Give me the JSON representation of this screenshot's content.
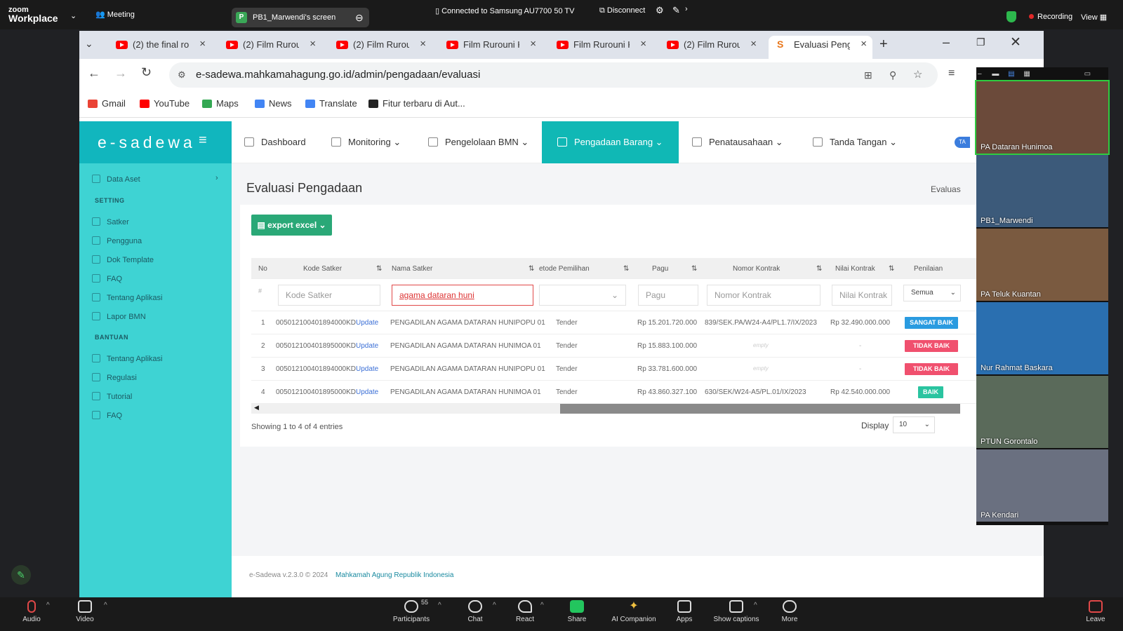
{
  "zoom": {
    "logo_top": "zoom",
    "logo_bottom": "Workplace",
    "meeting_label": "Meeting",
    "share_chip": "P",
    "screen_label": "PB1_Marwendi's screen",
    "connection": "Connected to Samsung AU7700 50 TV",
    "disconnect": "Disconnect",
    "recording": "Recording",
    "view": "View",
    "toolbar": {
      "audio": "Audio",
      "video": "Video",
      "participants": "Participants",
      "participant_count": "55",
      "chat": "Chat",
      "react": "React",
      "share": "Share",
      "ai_companion": "AI Companion",
      "apps": "Apps",
      "captions": "Show captions",
      "more": "More",
      "leave": "Leave"
    }
  },
  "browser": {
    "tabs": [
      {
        "label": "(2) the final ro"
      },
      {
        "label": "(2) Film Rurou"
      },
      {
        "label": "(2) Film Rurou"
      },
      {
        "label": "Film Rurouni K"
      },
      {
        "label": "Film Rurouni K"
      },
      {
        "label": "(2) Film Rurou"
      },
      {
        "label": "Evaluasi Peng"
      }
    ],
    "url": "e-sadewa.mahkamahagung.go.id/admin/pengadaan/evaluasi",
    "bookmarks": [
      "Gmail",
      "YouTube",
      "Maps",
      "News",
      "Translate",
      "Fitur terbaru di Aut..."
    ]
  },
  "app": {
    "logo": "e-sadewa",
    "user_badge": "TA",
    "nav": {
      "dashboard": "Dashboard",
      "monitoring": "Monitoring",
      "pengelolaan": "Pengelolaan BMN",
      "pengadaan": "Pengadaan Barang",
      "penatausahaan": "Penatausahaan",
      "tanda_tangan": "Tanda Tangan"
    },
    "sidebar": {
      "data_aset": "Data Aset",
      "setting_head": "SETTING",
      "setting_items": [
        "Satker",
        "Pengguna",
        "Dok Template",
        "FAQ",
        "Tentang Aplikasi",
        "Lapor BMN"
      ],
      "bantuan_head": "BANTUAN",
      "bantuan_items": [
        "Tentang Aplikasi",
        "Regulasi",
        "Tutorial",
        "FAQ"
      ]
    },
    "page_title": "Evaluasi Pengadaan",
    "breadcrumb": "Evaluas",
    "export_label": "export excel",
    "table": {
      "headers": {
        "no": "No",
        "kode": "Kode Satker",
        "nama": "Nama Satker",
        "metode": "etode Pemilihan",
        "pagu": "Pagu",
        "nomor": "Nomor Kontrak",
        "nilai": "Nilai Kontrak",
        "penilaian": "Penilaian"
      },
      "filters": {
        "hash": "#",
        "kode_placeholder": "Kode Satker",
        "nama_value": "agama dataran huni",
        "pagu_placeholder": "Pagu",
        "nomor_placeholder": "Nomor Kontrak",
        "nilai_placeholder": "Nilai Kontrak",
        "penilaian_value": "Semua"
      },
      "rows": [
        {
          "no": "1",
          "kode": "005012100401894000KD",
          "update": "Update",
          "nama": "PENGADILAN AGAMA DATARAN HUNIPOPU 01",
          "metode": "Tender",
          "pagu": "Rp 15.201.720.000",
          "nomor": "839/SEK.PA/W24-A4/PL1.7/IX/2023",
          "nilai": "Rp 32.490.000.000",
          "penilaian": "SANGAT BAIK",
          "color": "#2a9be0"
        },
        {
          "no": "2",
          "kode": "005012100401895000KD",
          "update": "Update",
          "nama": "PENGADILAN AGAMA DATARAN HUNIMOA 01",
          "metode": "Tender",
          "pagu": "Rp 15.883.100.000",
          "nomor": "empty",
          "nilai": "-",
          "penilaian": "TIDAK BAIK",
          "color": "#f0506e"
        },
        {
          "no": "3",
          "kode": "005012100401894000KD",
          "update": "Update",
          "nama": "PENGADILAN AGAMA DATARAN HUNIPOPU 01",
          "metode": "Tender",
          "pagu": "Rp 33.781.600.000",
          "nomor": "empty",
          "nilai": "-",
          "penilaian": "TIDAK BAIK",
          "color": "#f0506e"
        },
        {
          "no": "4",
          "kode": "005012100401895000KD",
          "update": "Update",
          "nama": "PENGADILAN AGAMA DATARAN HUNIMOA 01",
          "metode": "Tender",
          "pagu": "Rp 43.860.327.100",
          "nomor": "630/SEK/W24-A5/PL.01/IX/2023",
          "nilai": "Rp 42.540.000.000",
          "penilaian": "BAIK",
          "color": "#2ac4a0"
        }
      ]
    },
    "showing": "Showing 1 to 4 of 4 entries",
    "display_label": "Display",
    "display_value": "10",
    "footer_prefix": "e-Sadewa v.2.3.0 © 2024",
    "footer_link": "Mahkamah Agung Republik Indonesia"
  },
  "video_tiles": [
    {
      "name": "PA Dataran Hunimoa",
      "bg": "#6b4a3a"
    },
    {
      "name": "PB1_Marwendi",
      "bg": "#3c5a7a"
    },
    {
      "name": "PA Teluk Kuantan",
      "bg": "#7a5a40"
    },
    {
      "name": "Nur Rahmat Baskara",
      "bg": "#2a6fb0"
    },
    {
      "name": "PTUN Gorontalo",
      "bg": "#5a6a5a"
    },
    {
      "name": "PA Kendari",
      "bg": "#6a7080"
    }
  ],
  "colors": {
    "sidebar": "#3ed3d3",
    "logo_bg": "#11b6be",
    "active_nav": "#10b8b5",
    "export": "#2aa877"
  }
}
